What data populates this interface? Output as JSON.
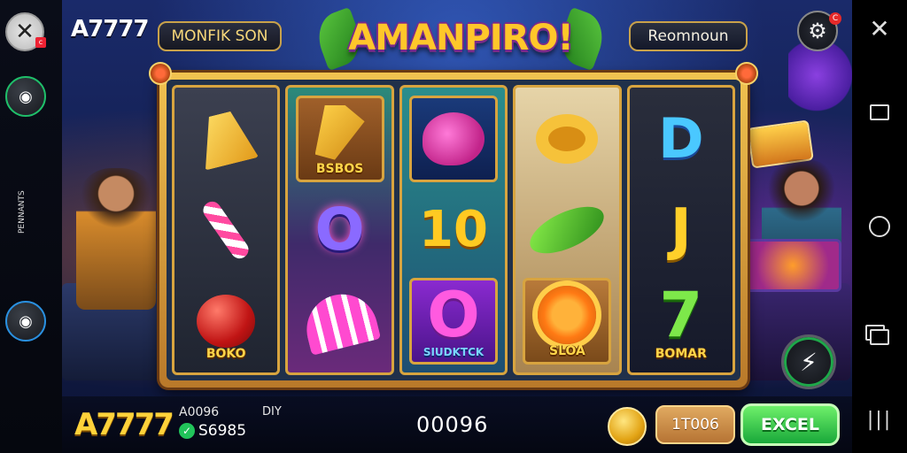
{
  "left_rail": {
    "close_icon": "close-icon",
    "side_label": "PENNANTS"
  },
  "top_bar": {
    "brand": "A7777",
    "mode_label": "MONFIK SON",
    "title": "AMANPIRO!",
    "return_label": "Reomnoun",
    "settings_badge": "C"
  },
  "reels": [
    {
      "symbols": [
        {
          "icon": "bell-icon",
          "label": ""
        },
        {
          "icon": "candy-cane-icon",
          "label": ""
        },
        {
          "icon": "apple-icon",
          "label": "BOKO"
        }
      ]
    },
    {
      "symbols": [
        {
          "icon": "wedge-icon",
          "label": "BSBOS"
        },
        {
          "glyph": "O",
          "icon": "letter-o-icon",
          "label": ""
        },
        {
          "icon": "umbrella-icon",
          "label": ""
        }
      ]
    },
    {
      "symbols": [
        {
          "icon": "fish-icon",
          "label": ""
        },
        {
          "glyph": "10",
          "icon": "ten-icon",
          "label": ""
        },
        {
          "glyph": "O",
          "icon": "letter-o-icon",
          "label": "SIUDKTCK"
        }
      ]
    },
    {
      "symbols": [
        {
          "icon": "ring-icon",
          "label": ""
        },
        {
          "icon": "leaf-icon",
          "label": ""
        },
        {
          "icon": "sun-icon",
          "label": "SLOA"
        }
      ]
    },
    {
      "symbols": [
        {
          "glyph": "D",
          "icon": "letter-d-icon",
          "label": ""
        },
        {
          "glyph": "J",
          "icon": "letter-j-icon",
          "label": ""
        },
        {
          "glyph": "7",
          "icon": "seven-icon",
          "label": "BOMAR"
        }
      ]
    }
  ],
  "bottom_bar": {
    "brand": "A7777",
    "balance_label": "A0096",
    "balance_value": "S6985",
    "win_label": "DIY",
    "center_value": "00096",
    "bet_value": "1T006",
    "action_label": "EXCEL"
  },
  "colors": {
    "gold": "#f1c350",
    "accent_green": "#19a83a",
    "title_yellow": "#ffc72a"
  }
}
